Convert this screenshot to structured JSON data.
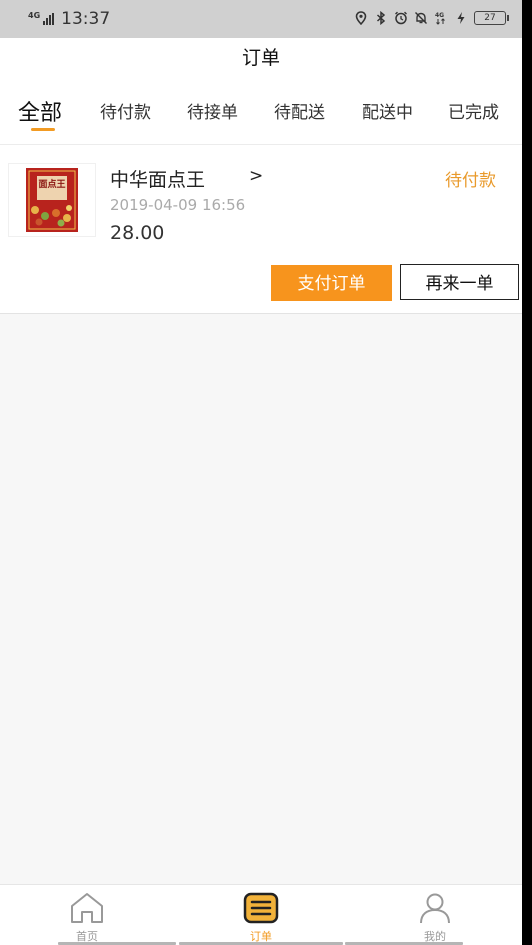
{
  "status_bar": {
    "network": "4G",
    "time": "13:37",
    "battery": "27",
    "icons": [
      "location-icon",
      "bluetooth-icon",
      "alarm-icon",
      "mute-icon",
      "4g-icon",
      "charging-icon"
    ]
  },
  "header": {
    "title": "订单"
  },
  "tabs": [
    {
      "label": "全部",
      "active": true
    },
    {
      "label": "待付款"
    },
    {
      "label": "待接单"
    },
    {
      "label": "待配送"
    },
    {
      "label": "配送中"
    },
    {
      "label": "已完成"
    }
  ],
  "order": {
    "store_name": "中华面点王",
    "arrow": ">",
    "status": "待付款",
    "time": "2019-04-09 16:56",
    "price": "28.00",
    "thumb_text": "面点王",
    "pay_label": "支付订单",
    "reorder_label": "再来一单"
  },
  "bottom_nav": [
    {
      "label": "首页",
      "icon": "home-icon"
    },
    {
      "label": "订单",
      "icon": "orders-icon",
      "active": true
    },
    {
      "label": "我的",
      "icon": "user-icon"
    }
  ],
  "colors": {
    "accent": "#f7941d",
    "status_text": "#e99a2b",
    "tab_indicator": "#f29b23"
  }
}
